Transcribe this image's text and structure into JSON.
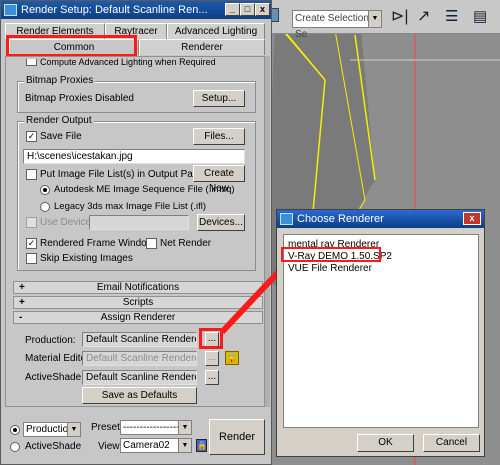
{
  "viewport": {
    "selection_set_placeholder": "Create Selection Se"
  },
  "main_window": {
    "title": "Render Setup: Default Scanline Ren...",
    "tabs_row1": [
      "Render Elements",
      "Raytracer",
      "Advanced Lighting"
    ],
    "tabs_row2": [
      "Common",
      "Renderer"
    ],
    "advanced_lighting_label": "Compute Advanced Lighting when Required",
    "bitmap_proxies": {
      "group_title": "Bitmap Proxies",
      "status": "Bitmap Proxies Disabled",
      "setup_button": "Setup..."
    },
    "render_output": {
      "group_title": "Render Output",
      "save_file_label": "Save File",
      "files_button": "Files...",
      "file_path": "H:\\scenes\\icestakan.jpg",
      "put_image_label": "Put Image File List(s) in Output Path(s)",
      "create_now_button": "Create Now",
      "autodesk_label": "Autodesk ME Image Sequence File (.imsq)",
      "legacy_label": "Legacy 3ds max Image File List (.ifl)",
      "use_device_label": "Use Device",
      "devices_button": "Devices...",
      "rendered_frame_window_label": "Rendered Frame Window",
      "net_render_label": "Net Render",
      "skip_existing_label": "Skip Existing Images"
    },
    "rollouts": {
      "email": "Email Notifications",
      "scripts": "Scripts",
      "assign": "Assign Renderer",
      "plus": "+",
      "minus": "-"
    },
    "assign_renderer": {
      "production_label": "Production:",
      "production_value": "Default Scanline Renderer",
      "material_editor_label": "Material Editor:",
      "material_editor_value": "Default Scanline Renderer",
      "activeshade_label": "ActiveShade:",
      "activeshade_value": "Default Scanline Renderer",
      "browse_button": "...",
      "save_defaults_button": "Save as Defaults"
    },
    "bottom": {
      "production_option": "Production",
      "activeshade_option": "ActiveShade",
      "preset_label": "Preset:",
      "preset_value": "-------------------",
      "view_label": "View:",
      "view_value": "Camera02",
      "render_button": "Render"
    }
  },
  "choose_renderer": {
    "title": "Choose Renderer",
    "items": [
      "mental ray Renderer",
      "V-Ray DEMO 1.50.SP2",
      "VUE File Renderer"
    ],
    "ok_button": "OK",
    "cancel_button": "Cancel"
  },
  "colors": {
    "highlight_red": "#ff1a1a",
    "titlebar_blue": "#0a3f86"
  }
}
